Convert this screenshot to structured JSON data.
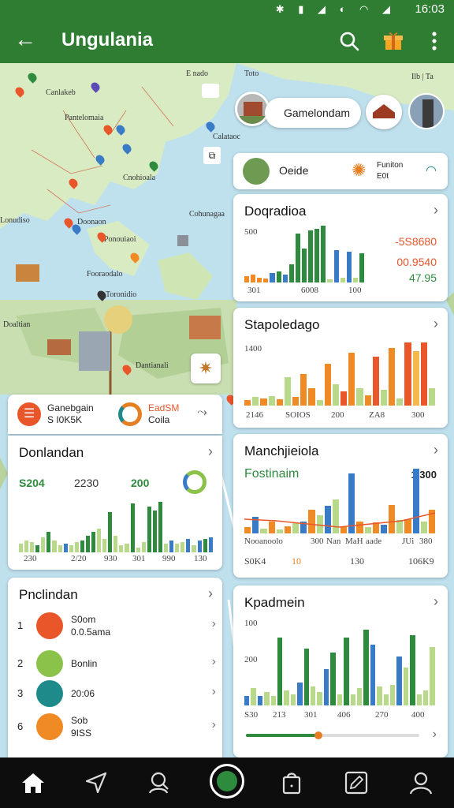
{
  "status": {
    "time": "16:03"
  },
  "appbar": {
    "title": "Ungulania"
  },
  "map": {
    "labels": [
      "E nado",
      "Toto",
      "Canlakeb",
      "Pantelomaia",
      "Calataoc",
      "Cnohioala",
      "Cohunagaa",
      "Lonudiso",
      "Doonaon",
      "Ponouiaoi",
      "Fooraodalo",
      "Toronidio",
      "Doaltian",
      "Dantianali"
    ],
    "corner_label": "Ilb | Ta"
  },
  "place_bubble": {
    "label": "Gamelondam"
  },
  "info_card": {
    "label": "Oeide",
    "meta1": "Funiton",
    "meta2": "E0t"
  },
  "card1": {
    "title": "Doqradioa",
    "y_top": "500",
    "x_labels": [
      "301",
      "6008",
      "100"
    ],
    "values": [
      "-5S8680",
      "00.9540",
      "47.95"
    ],
    "bars": [
      8,
      10,
      6,
      5,
      12,
      14,
      10,
      22,
      60,
      42,
      64,
      66,
      70,
      4,
      40,
      6,
      38,
      6,
      36
    ],
    "colors": [
      "#f08a24",
      "#f08a24",
      "#f08a24",
      "#f08a24",
      "#3a7bc8",
      "#2e8b3e",
      "#3a7bc8",
      "#2e8b3e",
      "#2e8b3e",
      "#2e8b3e",
      "#2e8b3e",
      "#2e8b3e",
      "#2e8b3e",
      "#b8d98a",
      "#3a7bc8",
      "#b8d98a",
      "#3a7bc8",
      "#b8d98a",
      "#2e8b3e"
    ]
  },
  "card2": {
    "title": "Stapoledago",
    "y_top": "1400",
    "x_labels": [
      "2146",
      "SOIOS",
      "200",
      "ZA8",
      "300"
    ],
    "bars": [
      8,
      12,
      10,
      14,
      9,
      40,
      12,
      45,
      25,
      8,
      60,
      30,
      20,
      75,
      25,
      15,
      70,
      22,
      82,
      10,
      90,
      78,
      90,
      25
    ],
    "colors": [
      "#f08a24",
      "#b8d98a",
      "#f08a24",
      "#b8d98a",
      "#f08a24",
      "#b8d98a",
      "#f08a24",
      "#f08a24",
      "#f08a24",
      "#b8d98a",
      "#f08a24",
      "#b8d98a",
      "#e8562a",
      "#f08a24",
      "#b8d98a",
      "#f08a24",
      "#e8562a",
      "#b8d98a",
      "#f08a24",
      "#b8d98a",
      "#e8562a",
      "#f5b84c",
      "#e8562a",
      "#b8d98a"
    ]
  },
  "card3": {
    "title": "Manchjieiola",
    "subtitle": "Fostinaim",
    "right_label": "1.300",
    "x_labels": [
      "Nooanoolo",
      "300",
      "Nan",
      "MaH",
      "aade",
      "JUi",
      "380"
    ],
    "bottom": [
      "S0K4",
      "10",
      "130",
      "106K9"
    ],
    "bars": [
      10,
      28,
      8,
      20,
      6,
      12,
      18,
      20,
      40,
      30,
      46,
      56,
      10,
      100,
      20,
      10,
      18,
      14,
      48,
      22,
      24,
      108,
      20,
      40
    ],
    "colors": [
      "#f08a24",
      "#3a7bc8",
      "#b8d98a",
      "#f08a24",
      "#b8d98a",
      "#f08a24",
      "#b8d98a",
      "#3a7bc8",
      "#f08a24",
      "#b8d98a",
      "#3a7bc8",
      "#b8d98a",
      "#f08a24",
      "#3a7bc8",
      "#f08a24",
      "#b8d98a",
      "#f08a24",
      "#3a7bc8",
      "#f08a24",
      "#b8d98a",
      "#f08a24",
      "#3a7bc8",
      "#b8d98a",
      "#f08a24"
    ]
  },
  "card4": {
    "title": "Kpadmein",
    "y_top": "100",
    "y_mid": "200",
    "x_labels": [
      "S30",
      "213",
      "301",
      "406",
      "270",
      "400"
    ],
    "bars": [
      10,
      18,
      10,
      14,
      10,
      72,
      16,
      12,
      24,
      60,
      20,
      14,
      38,
      56,
      12,
      72,
      12,
      18,
      80,
      64,
      20,
      12,
      22,
      52,
      40,
      74,
      12,
      16,
      62
    ],
    "colors": [
      "#3a7bc8",
      "#b8d98a",
      "#3a7bc8",
      "#b8d98a",
      "#b8d98a",
      "#2e8b3e",
      "#b8d98a",
      "#b8d98a",
      "#3a7bc8",
      "#2e8b3e",
      "#b8d98a",
      "#b8d98a",
      "#3a7bc8",
      "#2e8b3e",
      "#b8d98a",
      "#2e8b3e",
      "#b8d98a",
      "#b8d98a",
      "#2e8b3e",
      "#3a7bc8",
      "#b8d98a",
      "#b8d98a",
      "#b8d98a",
      "#3a7bc8",
      "#b8d98a",
      "#2e8b3e",
      "#b8d98a",
      "#b8d98a",
      "#b8d98a"
    ]
  },
  "summary_card": {
    "line1": "Ganebgain",
    "line2": "S I0K5K",
    "chip1": "EadSM",
    "chip2": "Coila"
  },
  "card5": {
    "title": "Donlandan",
    "values": [
      "S204",
      "2230",
      "200"
    ],
    "x_labels": [
      "230",
      "2/20",
      "930",
      "301",
      "990",
      "130"
    ],
    "bars": [
      10,
      14,
      12,
      8,
      18,
      24,
      14,
      8,
      10,
      8,
      12,
      14,
      20,
      24,
      28,
      16,
      48,
      20,
      8,
      10,
      58,
      6,
      12,
      54,
      50,
      60,
      10,
      14,
      10,
      12,
      16,
      8,
      14,
      16,
      18
    ],
    "colors": [
      "#b8d98a",
      "#b8d98a",
      "#b8d98a",
      "#2e8b3e",
      "#b8d98a",
      "#2e8b3e",
      "#b8d98a",
      "#b8d98a",
      "#3a7bc8",
      "#b8d98a",
      "#b8d98a",
      "#2e8b3e",
      "#2e8b3e",
      "#2e8b3e",
      "#b8d98a",
      "#b8d98a",
      "#2e8b3e",
      "#b8d98a",
      "#b8d98a",
      "#b8d98a",
      "#2e8b3e",
      "#b8d98a",
      "#b8d98a",
      "#2e8b3e",
      "#2e8b3e",
      "#2e8b3e",
      "#b8d98a",
      "#3a7bc8",
      "#b8d98a",
      "#b8d98a",
      "#3a7bc8",
      "#b8d98a",
      "#3a7bc8",
      "#2e8b3e",
      "#3a7bc8"
    ]
  },
  "card6": {
    "title": "Pnclindan",
    "rows": [
      {
        "num": "1",
        "l1": "S0om",
        "l2": "0.0.5ama",
        "color": "#e8562a"
      },
      {
        "num": "2",
        "l1": "Bonlin",
        "l2": "",
        "color": "#8bc34a"
      },
      {
        "num": "3",
        "l1": "20:06",
        "l2": "",
        "color": "#1f8a8a"
      },
      {
        "num": "6",
        "l1": "Sob",
        "l2": "9ISS",
        "color": "#f08a24"
      }
    ]
  },
  "progress": {
    "fraction": 0.42
  }
}
